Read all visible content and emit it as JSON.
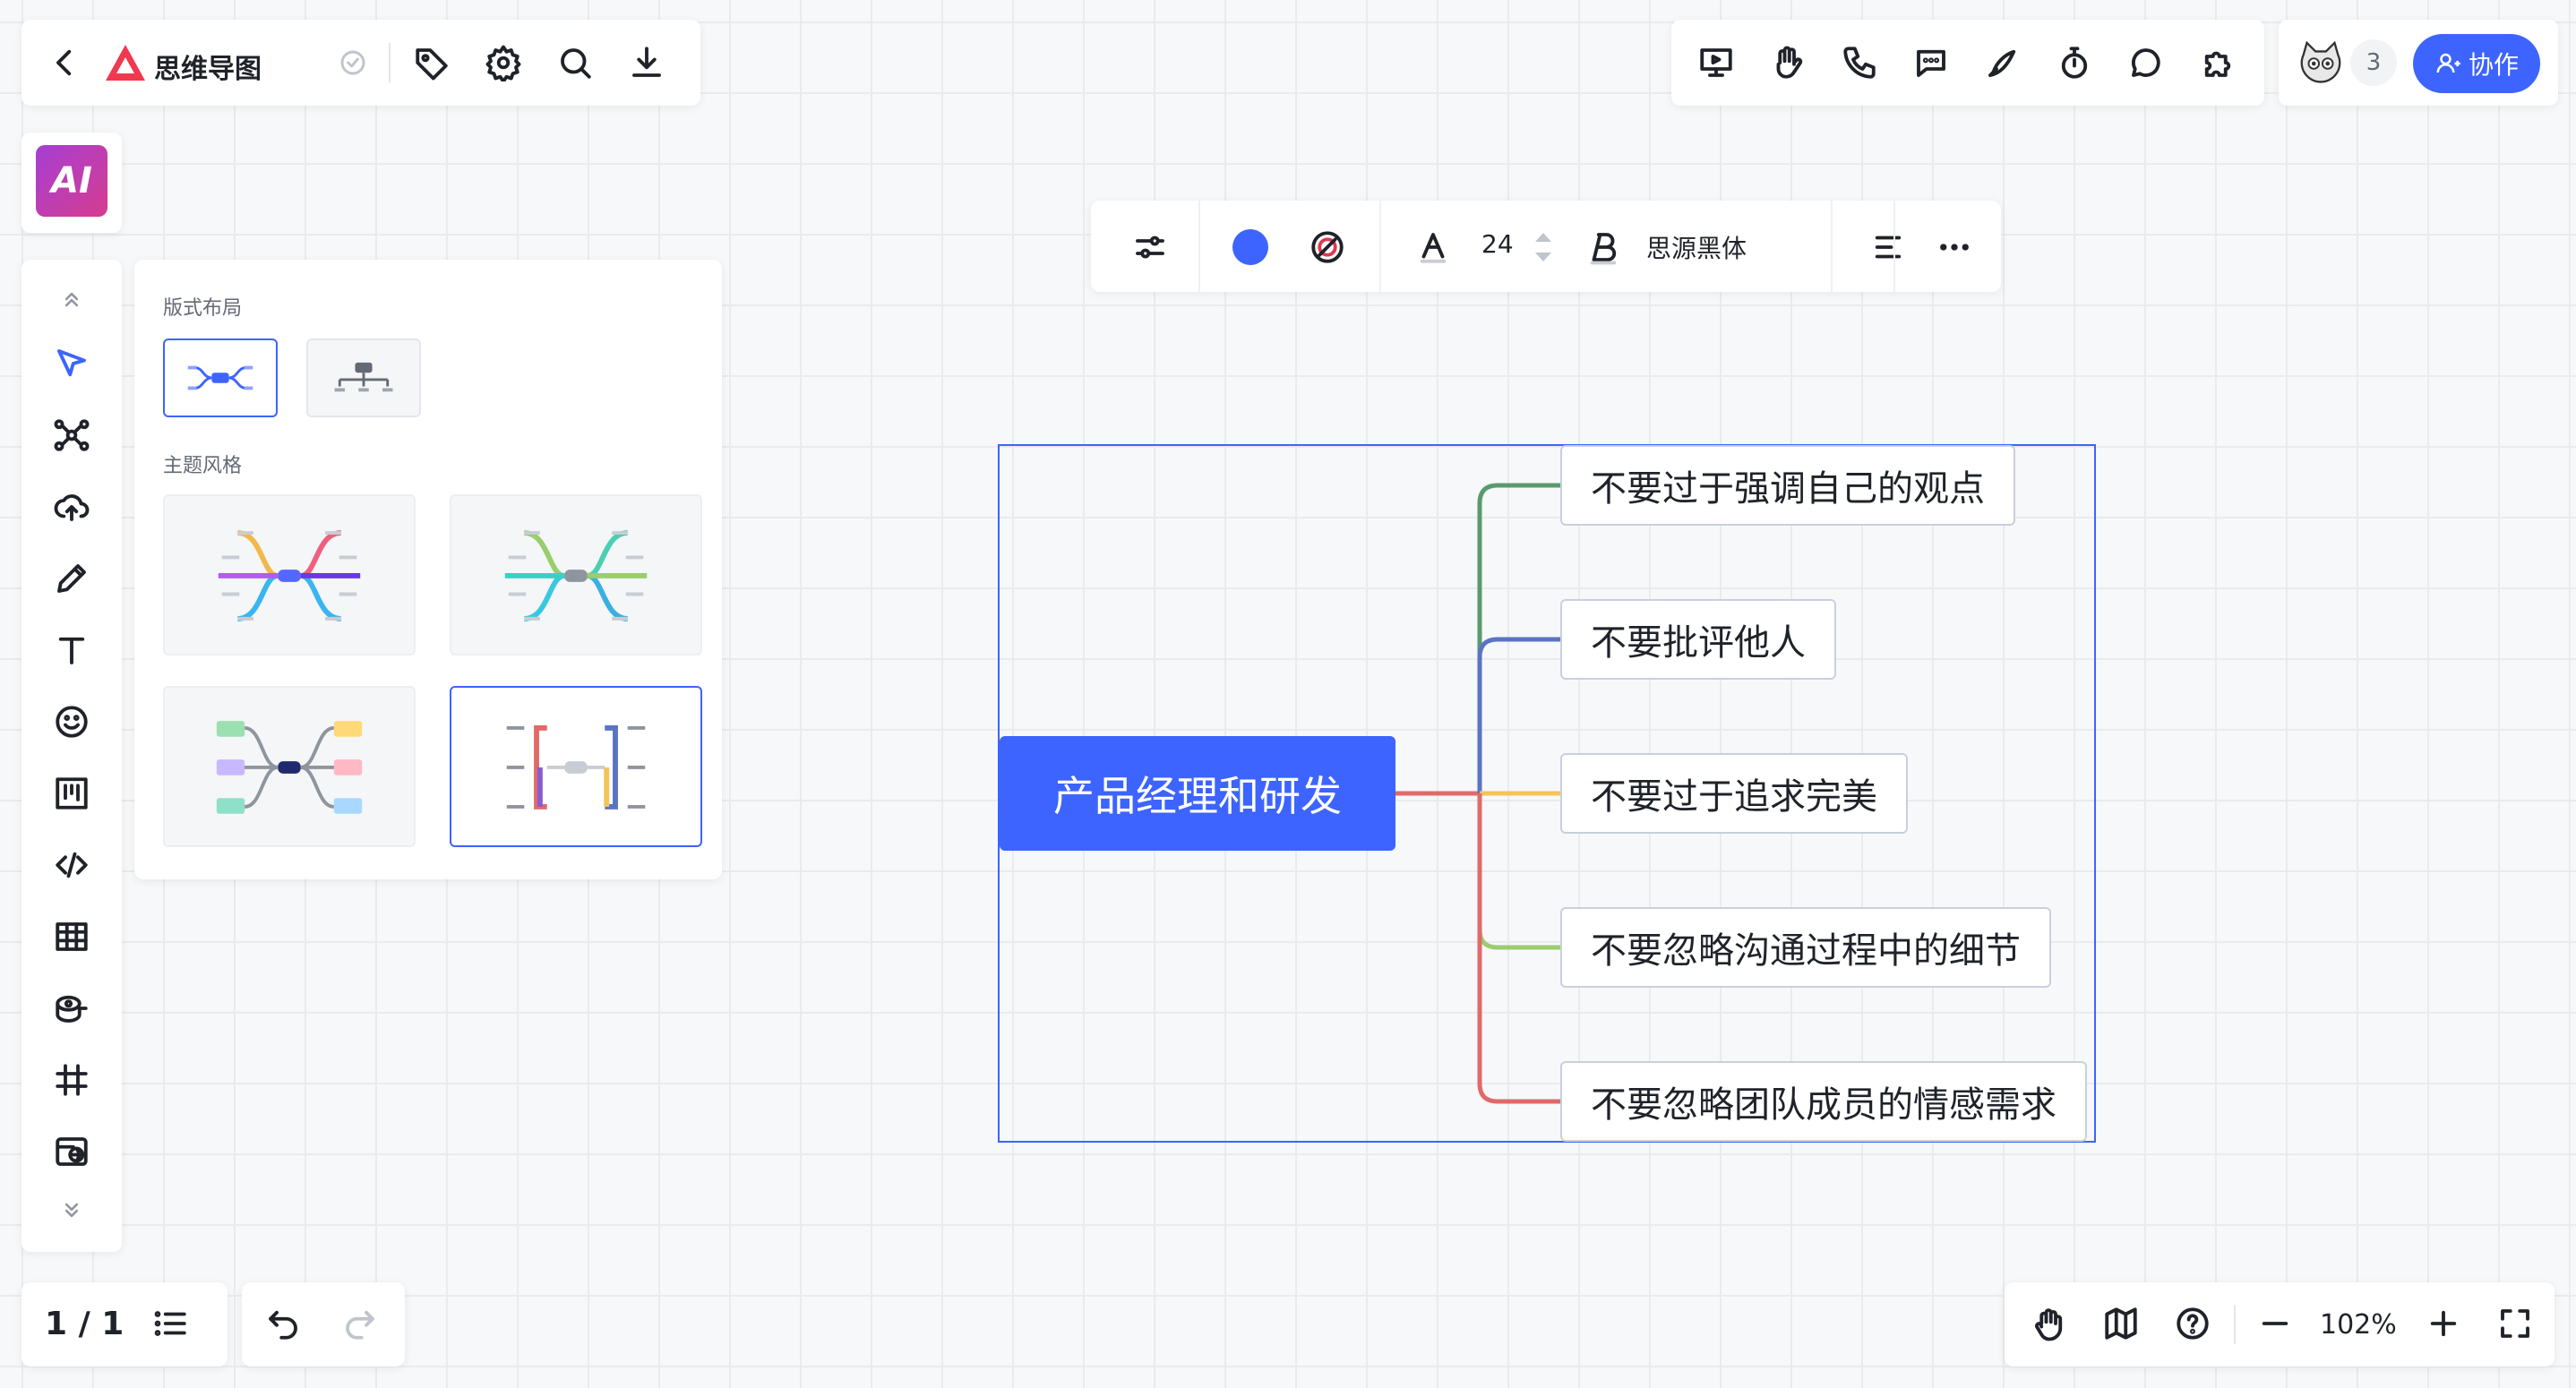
{
  "header": {
    "title": "思维导图"
  },
  "collab": {
    "avatar_count": "3",
    "button_label": "协作"
  },
  "ai": {
    "label": "AI"
  },
  "layout_popup": {
    "layout_label": "版式布局",
    "theme_label": "主题风格"
  },
  "format_bar": {
    "color": "#3d64ff",
    "font_size": "24",
    "font_name": "思源黑体"
  },
  "mindmap": {
    "root": "产品经理和研发",
    "children": [
      {
        "text": "不要过于强调自己的观点",
        "color": "#5a9a6e"
      },
      {
        "text": "不要批评他人",
        "color": "#5a74c4"
      },
      {
        "text": "不要过于追求完美",
        "color": "#f2c45a"
      },
      {
        "text": "不要忽略沟通过程中的细节",
        "color": "#9acd6e"
      },
      {
        "text": "不要忽略团队成员的情感需求",
        "color": "#e06a6a"
      }
    ]
  },
  "footer": {
    "page": "1 / 1",
    "zoom": "102%"
  },
  "colors": {
    "accent": "#3d64ff",
    "ai_gradient_start": "#a63fd4",
    "ai_gradient_end": "#d63c8f"
  }
}
